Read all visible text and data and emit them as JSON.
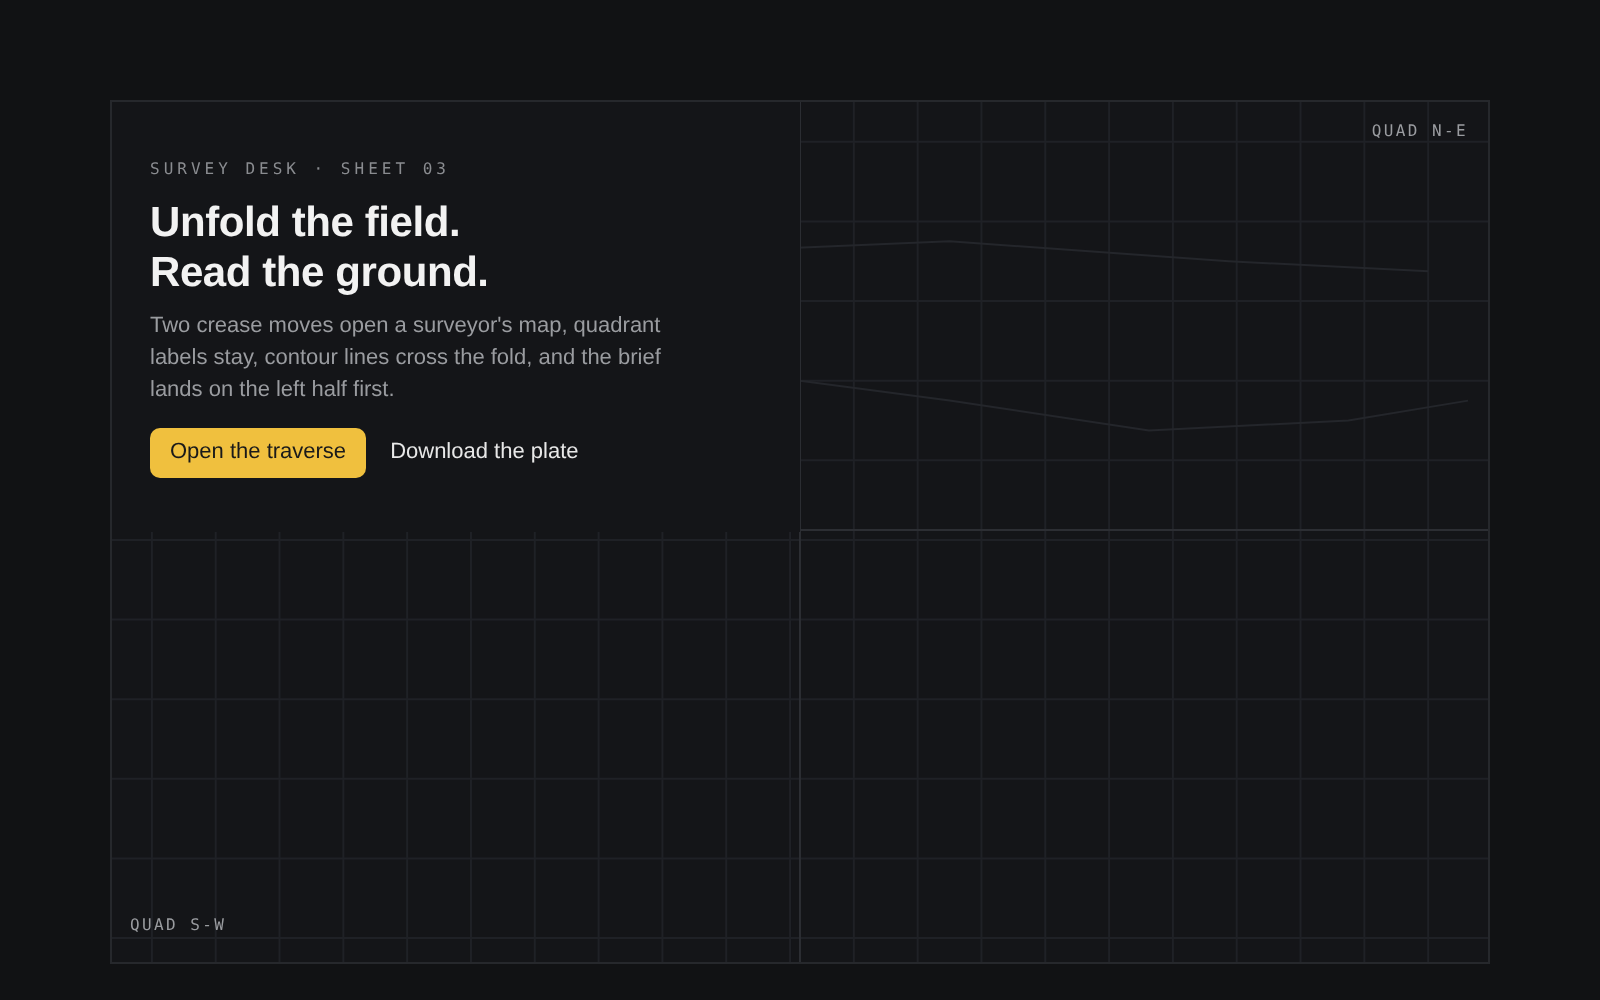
{
  "brief": {
    "eyebrow": "SURVEY DESK · SHEET 03",
    "title_lines": [
      "Unfold the field.",
      "Read the ground."
    ],
    "body": "Two crease moves open a surveyor's map, quadrant labels stay, contour lines cross the fold, and the brief lands on the left half first.",
    "actions": [
      {
        "label": "Open the traverse",
        "kind": "primary"
      },
      {
        "label": "Download the plate",
        "kind": "link"
      }
    ]
  },
  "quadrants": {
    "north_east": "QUAD N-E",
    "south_west": "QUAD S-W"
  }
}
